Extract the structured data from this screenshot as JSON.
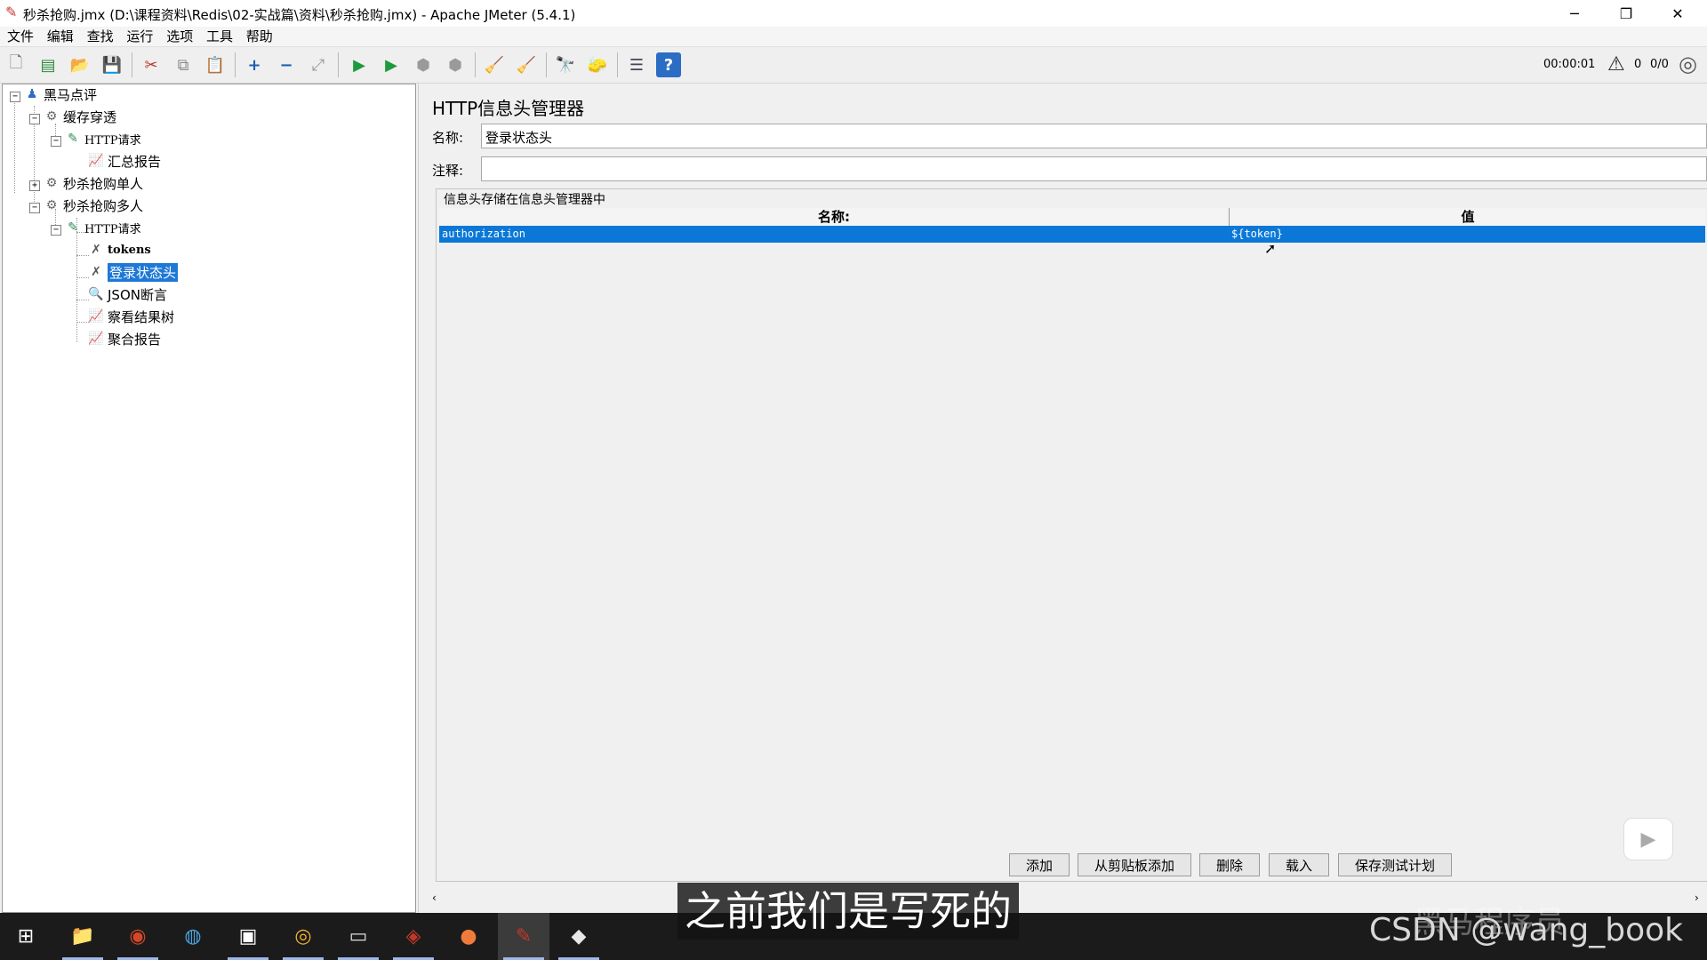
{
  "window": {
    "title": "秒杀抢购.jmx (D:\\课程资料\\Redis\\02-实战篇\\资料\\秒杀抢购.jmx) - Apache JMeter (5.4.1)",
    "minimize": "─",
    "restore": "❐",
    "close": "✕"
  },
  "menu": [
    "文件",
    "编辑",
    "查找",
    "运行",
    "选项",
    "工具",
    "帮助"
  ],
  "toolbar": {
    "timer": "00:00:01",
    "warn_count": "0",
    "threads": "0/0"
  },
  "tree": {
    "root": "黑马点评",
    "group1": "缓存穿透",
    "group1_req": "HTTP请求",
    "group1_report": "汇总报告",
    "group2": "秒杀抢购单人",
    "group3": "秒杀抢购多人",
    "group3_req": "HTTP请求",
    "tokens": "tokens",
    "login_header": "登录状态头",
    "json_assert": "JSON断言",
    "view_tree": "察看结果树",
    "agg_report": "聚合报告"
  },
  "panel": {
    "title": "HTTP信息头管理器",
    "name_label": "名称:",
    "name_value": "登录状态头",
    "comment_label": "注释:",
    "comment_value": "",
    "table_title": "信息头存储在信息头管理器中",
    "col_name": "名称:",
    "col_value": "值",
    "rows": [
      {
        "name": "authorization",
        "value": "${token}"
      }
    ],
    "buttons": {
      "add": "添加",
      "add_clipboard": "从剪贴板添加",
      "delete": "删除",
      "load": "载入",
      "save_plan": "保存测试计划"
    }
  },
  "overlay": {
    "subtitle": "之前我们是写死的",
    "watermark": "CSDN @wang_book",
    "watermark_brand": "黑马程序员"
  }
}
